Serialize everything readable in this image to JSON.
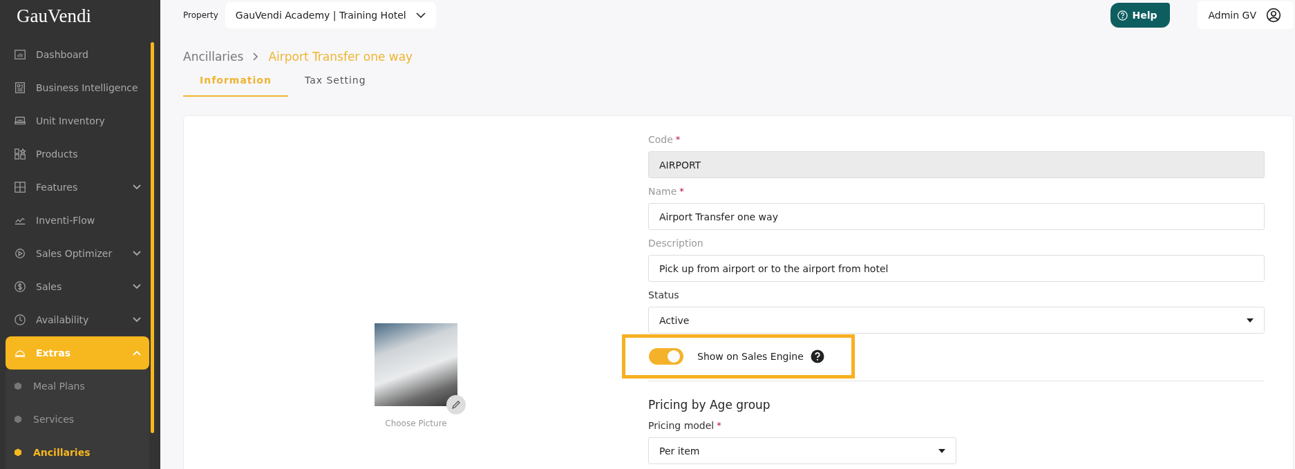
{
  "sidebar": {
    "logo": "GauVendi",
    "items": [
      {
        "label": "Dashboard",
        "selected": false
      },
      {
        "label": "Business Intelligence",
        "selected": false
      },
      {
        "label": "Unit Inventory",
        "selected": false
      },
      {
        "label": "Products",
        "selected": false
      },
      {
        "label": "Features",
        "selected": false,
        "expanded": false
      },
      {
        "label": "Inventi-Flow",
        "selected": false
      },
      {
        "label": "Sales Optimizer",
        "selected": false,
        "expanded": false
      },
      {
        "label": "Sales",
        "selected": false,
        "expanded": false
      },
      {
        "label": "Availability",
        "selected": false,
        "expanded": false
      },
      {
        "label": "Extras",
        "selected": true,
        "expanded": true,
        "children": [
          {
            "label": "Meal Plans",
            "selected": false
          },
          {
            "label": "Services",
            "selected": false
          },
          {
            "label": "Ancillaries",
            "selected": true
          }
        ]
      }
    ]
  },
  "header": {
    "property_label": "Property",
    "property_value": "GauVendi Academy | Training Hotel",
    "help": "Help",
    "user": "Admin GV"
  },
  "breadcrumb": [
    "Ancillaries",
    "Airport Transfer one way"
  ],
  "tabs": [
    {
      "label": "Information",
      "selected": true
    },
    {
      "label": "Tax Setting",
      "selected": false
    }
  ],
  "picture": {
    "caption": "Choose Picture"
  },
  "form": {
    "fields": [
      {
        "kind": "text",
        "label": "Code",
        "required_mark": "*",
        "value": "AIRPORT",
        "disabled": true
      },
      {
        "kind": "text",
        "label": "Name",
        "required_mark": "*",
        "value": "Airport Transfer one way",
        "disabled": false
      },
      {
        "kind": "text",
        "label": "Description",
        "value": "Pick up from airport or to the airport from hotel",
        "disabled": false
      },
      {
        "kind": "select",
        "label": "Status",
        "value": "Active",
        "disabled": false
      }
    ],
    "toggle": {
      "label": "Show on Sales Engine",
      "on": true,
      "highlighted": true
    },
    "section_title": "Pricing by Age group",
    "pricing_model": {
      "label": "Pricing model",
      "required_mark": "*",
      "value": "Per item"
    }
  }
}
